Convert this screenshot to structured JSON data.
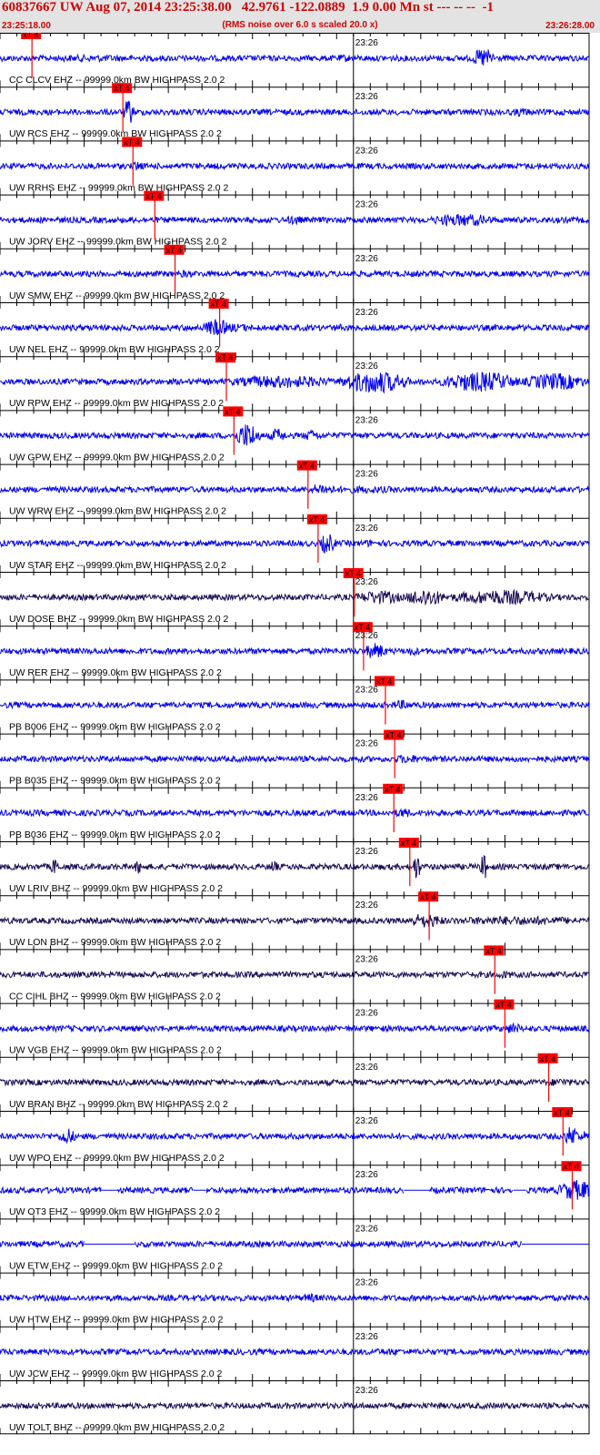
{
  "header": {
    "title": "60837667 UW Aug 07, 2014 23:25:38.00   42.9761 -122.0889  1.9 0.00 Mn st --- -- --  -1",
    "subtitle": "(RMS noise over 6.0 s scaled 20.0 x)",
    "start_time": "23:25:18.00",
    "end_time": "23:26:28.00"
  },
  "colors": {
    "header_bg": "#e3e3e3",
    "header_text": "#d00000",
    "trace_blue": "#0000ee",
    "trace_dark": "#1a0a55",
    "pick_red": "#ff0000",
    "axis": "#000000"
  },
  "chart_data": {
    "type": "line",
    "time_range": [
      "23:25:18.00",
      "23:26:28.00"
    ],
    "minute_label": "23:26",
    "minute_tick_time": "23:26:00",
    "pick_label": "xT 4",
    "traces": [
      {
        "label": "CC CLCV EHZ -- 99999.0km BW  HIGHPASS  2.0  2",
        "color": "blue",
        "pick_s": 3.8,
        "bursts": [
          [
            6,
            16,
            1.2
          ],
          [
            56,
            59,
            3.5
          ],
          [
            40,
            42,
            1.3
          ]
        ]
      },
      {
        "label": "UW RCS EHZ -- 99999.0km BW  HIGHPASS  2.0  2",
        "color": "blue",
        "pick_s": 14.6,
        "bursts": [
          [
            14.6,
            16,
            4.5
          ],
          [
            61,
            63,
            1.6
          ]
        ]
      },
      {
        "label": "UW RRHS EHZ -- 99999.0km BW  HIGHPASS  2.0  2",
        "color": "blue",
        "pick_s": 15.8,
        "bursts": [
          [
            15.8,
            17,
            1.8
          ]
        ]
      },
      {
        "label": "UW JORV EHZ -- 99999.0km BW  HIGHPASS  2.0  2",
        "color": "blue",
        "pick_s": 18.4,
        "bursts": [
          [
            34,
            36,
            1.6
          ],
          [
            51,
            59,
            2.2
          ]
        ]
      },
      {
        "label": "UW SMW EHZ -- 99999.0km BW  HIGHPASS  2.0  2",
        "color": "blue",
        "pick_s": 20.8,
        "bursts": [
          [
            20.8,
            23,
            1.3
          ]
        ]
      },
      {
        "label": "UW NEL EHZ -- 99999.0km BW  HIGHPASS  2.0  2",
        "color": "blue",
        "pick_s": 26.1,
        "bursts": [
          [
            24,
            27.5,
            3.0
          ],
          [
            26,
            30,
            1.5
          ],
          [
            39.5,
            41,
            1.3
          ]
        ]
      },
      {
        "label": "UW RPW EHZ -- 99999.0km BW  HIGHPASS  2.0  2",
        "color": "blue",
        "pick_s": 26.9,
        "bursts": [
          [
            26.9,
            40,
            2.2
          ],
          [
            40,
            49,
            4.0
          ],
          [
            52,
            62,
            3.5
          ],
          [
            62,
            70,
            3.0
          ]
        ]
      },
      {
        "label": "UW GPW EHZ -- 99999.0km BW  HIGHPASS  2.0  2",
        "color": "blue",
        "pick_s": 27.8,
        "bursts": [
          [
            27.8,
            31,
            4.5
          ],
          [
            32,
            34,
            2.5
          ],
          [
            36,
            38,
            2.0
          ]
        ]
      },
      {
        "label": "UW WRW EHZ -- 99999.0km BW  HIGHPASS  2.0  2",
        "color": "blue",
        "pick_s": 36.6,
        "bursts": [
          [
            36.6,
            40,
            2.0
          ],
          [
            40,
            47,
            1.3
          ]
        ]
      },
      {
        "label": "UW STAR EHZ -- 99999.0km BW  HIGHPASS  2.0  2",
        "color": "blue",
        "pick_s": 37.8,
        "bursts": [
          [
            37.8,
            40,
            3.5
          ],
          [
            43,
            45,
            1.3
          ]
        ]
      },
      {
        "label": "UW DOSE BHZ -- 99999.0km BW  HIGHPASS  2.0  2",
        "color": "dark",
        "pick_s": 42.1,
        "bursts": [
          [
            42.1,
            48,
            2.4
          ],
          [
            48,
            53,
            3.2
          ],
          [
            53,
            66,
            2.6
          ]
        ]
      },
      {
        "label": "UW RER EHZ -- 99999.0km BW  HIGHPASS  2.0  2",
        "color": "blue",
        "pick_s": 43.2,
        "bursts": [
          [
            43.2,
            46,
            2.8
          ],
          [
            48,
            50,
            1.5
          ]
        ]
      },
      {
        "label": "PB B006 EHZ -- 99999.0km BW  HIGHPASS  2.0  2",
        "color": "blue",
        "pick_s": 45.8,
        "bursts": [
          [
            46.5,
            49,
            1.7
          ]
        ]
      },
      {
        "label": "PB B035 EHZ -- 99999.0km BW  HIGHPASS  2.0  2",
        "color": "blue",
        "pick_s": 46.9,
        "bursts": [
          [
            46.9,
            50,
            1.6
          ]
        ]
      },
      {
        "label": "PB B036 EHZ -- 99999.0km BW  HIGHPASS  2.0  2",
        "color": "blue",
        "pick_s": 46.8,
        "bursts": [
          [
            46.8,
            49,
            1.7
          ]
        ]
      },
      {
        "label": "UW LRIV BHZ -- 99999.0km BW  HIGHPASS  2.0  2",
        "color": "dark",
        "pick_s": 48.7,
        "bursts": [
          [
            49,
            50,
            5.0
          ],
          [
            6,
            7,
            3.0
          ],
          [
            16,
            17,
            2.5
          ],
          [
            32,
            33,
            2.5
          ],
          [
            57,
            58,
            4.5
          ]
        ]
      },
      {
        "label": "UW LON BHZ -- 99999.0km BW  HIGHPASS  2.0  2",
        "color": "dark",
        "pick_s": 51.0,
        "bursts": [
          [
            48,
            53,
            2.5
          ],
          [
            53,
            70,
            1.6
          ]
        ]
      },
      {
        "label": "CC CIHL BHZ -- 99999.0km BW  HIGHPASS  2.0  2",
        "color": "dark",
        "pick_s": 58.8,
        "bursts": [
          [
            58.8,
            61,
            1.4
          ]
        ]
      },
      {
        "label": "UW VGB EHZ -- 99999.0km BW  HIGHPASS  2.0  2",
        "color": "blue",
        "pick_s": 60.0,
        "bursts": [
          [
            60,
            62,
            2.0
          ]
        ]
      },
      {
        "label": "UW BRAN BHZ -- 99999.0km BW  HIGHPASS  2.0  2",
        "color": "dark",
        "pick_s": 65.2,
        "bursts": [
          [
            65.2,
            68,
            1.5
          ]
        ]
      },
      {
        "label": "UW WPO EHZ -- 99999.0km BW  HIGHPASS  2.0  2",
        "color": "blue",
        "pick_s": 66.9,
        "bursts": [
          [
            7,
            9,
            3.0
          ],
          [
            66.9,
            69,
            3.5
          ],
          [
            69,
            70,
            2.0
          ]
        ]
      },
      {
        "label": "UW OT3 EHZ -- 99999.0km BW  HIGHPASS  2.0  2",
        "color": "blue",
        "pick_s": 68.0,
        "bursts": [
          [
            66,
            71,
            3.5
          ]
        ],
        "gaps": [
          [
            12,
            14
          ],
          [
            23,
            24.5
          ],
          [
            48,
            51
          ],
          [
            61,
            62.5
          ],
          [
            72,
            73
          ]
        ]
      },
      {
        "label": "UW ETW EHZ -- 99999.0km BW  HIGHPASS  2.0  2",
        "color": "blue",
        "pick_s": null,
        "bursts": [],
        "gaps": [
          [
            10,
            16
          ],
          [
            62,
            70
          ]
        ]
      },
      {
        "label": "UW HTW EHZ -- 99999.0km BW  HIGHPASS  2.0  2",
        "color": "blue",
        "pick_s": null,
        "bursts": [
          [
            36,
            38,
            1.6
          ]
        ]
      },
      {
        "label": "UW JCW EHZ -- 99999.0km BW  HIGHPASS  2.0  2",
        "color": "blue",
        "pick_s": null,
        "bursts": [
          [
            44,
            48,
            1.2
          ]
        ]
      },
      {
        "label": "UW TOLT BHZ -- 99999.0km BW  HIGHPASS  2.0  2",
        "color": "dark",
        "pick_s": null,
        "bursts": []
      }
    ]
  }
}
